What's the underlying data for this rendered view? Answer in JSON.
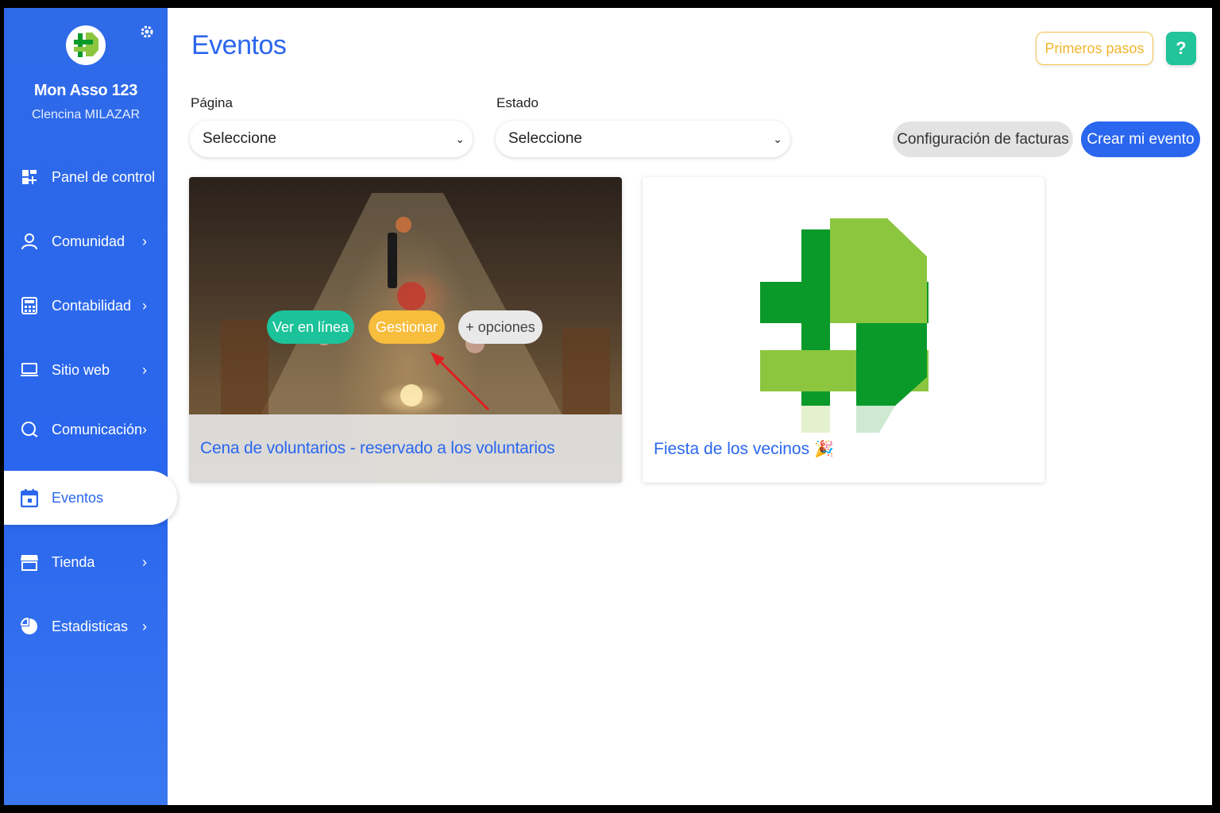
{
  "sidebar": {
    "org_name": "Mon Asso 123",
    "org_user": "Clencina MILAZAR",
    "items": [
      {
        "label": "Panel de control",
        "icon": "dashboard-icon",
        "chevron": false
      },
      {
        "label": "Comunidad",
        "icon": "users-icon",
        "chevron": true
      },
      {
        "label": "Contabilidad",
        "icon": "calculator-icon",
        "chevron": true
      },
      {
        "label": "Sitio web",
        "icon": "laptop-icon",
        "chevron": true
      },
      {
        "label": "Comunicación",
        "icon": "chat-icon",
        "chevron": true
      },
      {
        "label": "Eventos",
        "icon": "calendar-icon",
        "chevron": false,
        "active": true
      },
      {
        "label": "Tienda",
        "icon": "store-icon",
        "chevron": true
      },
      {
        "label": "Estadisticas",
        "icon": "pie-chart-icon",
        "chevron": true
      }
    ]
  },
  "header": {
    "title": "Eventos",
    "primeros_label": "Primeros pasos",
    "help_label": "?"
  },
  "filters": {
    "pagina_label": "Página",
    "pagina_value": "Seleccione",
    "estado_label": "Estado",
    "estado_value": "Seleccione"
  },
  "actions": {
    "config_label": "Configuración de facturas",
    "crear_label": "Crear mi evento"
  },
  "events": [
    {
      "title": "Cena de voluntarios - reservado a los voluntarios",
      "ver_label": "Ver en línea",
      "gestionar_label": "Gestionar",
      "opciones_label": "+ opciones"
    },
    {
      "title": "Fiesta de los vecinos",
      "emoji": "🎉"
    }
  ],
  "colors": {
    "sidebar": "#2a66ee",
    "accent_green": "#1cc39a",
    "accent_yellow": "#f7bd3c",
    "annotation_arrow": "#e02020"
  }
}
